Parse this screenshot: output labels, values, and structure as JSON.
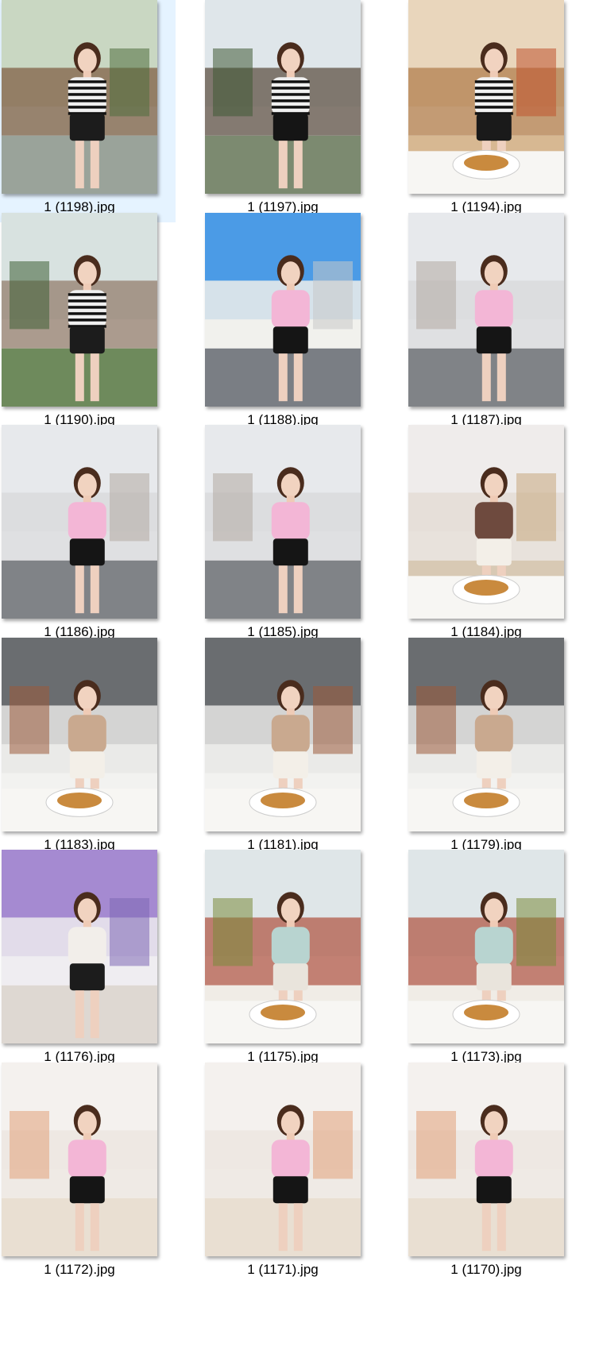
{
  "files": [
    {
      "name": "1 (1198).jpg",
      "selected": true,
      "scene": "garden-brick",
      "top_color": "#f0f0f0",
      "bottom_color": "#1c1c1c",
      "striped": true
    },
    {
      "name": "1 (1197).jpg",
      "selected": false,
      "scene": "garden-house",
      "top_color": "#f0f0f0",
      "bottom_color": "#151515",
      "striped": true
    },
    {
      "name": "1 (1194).jpg",
      "selected": false,
      "scene": "cafe-warm",
      "top_color": "#f2f2f2",
      "bottom_color": "#1a1a1a",
      "striped": true
    },
    {
      "name": "1 (1190).jpg",
      "selected": false,
      "scene": "garden-path",
      "top_color": "#f0f0f0",
      "bottom_color": "#1c1c1c",
      "striped": true
    },
    {
      "name": "1 (1188).jpg",
      "selected": false,
      "scene": "street-sky",
      "top_color": "#f3b6d6",
      "bottom_color": "#151515",
      "striped": false
    },
    {
      "name": "1 (1187).jpg",
      "selected": false,
      "scene": "shopfront",
      "top_color": "#f3b6d6",
      "bottom_color": "#151515",
      "striped": false
    },
    {
      "name": "1 (1186).jpg",
      "selected": false,
      "scene": "shopfront",
      "top_color": "#f3b6d6",
      "bottom_color": "#151515",
      "striped": false
    },
    {
      "name": "1 (1185).jpg",
      "selected": false,
      "scene": "shopfront",
      "top_color": "#f3b6d6",
      "bottom_color": "#151515",
      "striped": false
    },
    {
      "name": "1 (1184).jpg",
      "selected": false,
      "scene": "cafe-white",
      "top_color": "#6e4a3e",
      "bottom_color": "#f3efe8",
      "striped": false
    },
    {
      "name": "1 (1183).jpg",
      "selected": false,
      "scene": "cafe-grey",
      "top_color": "#c9a98f",
      "bottom_color": "#f3efe8",
      "striped": false
    },
    {
      "name": "1 (1181).jpg",
      "selected": false,
      "scene": "cafe-grey",
      "top_color": "#c9a98f",
      "bottom_color": "#f3efe8",
      "striped": false
    },
    {
      "name": "1 (1179).jpg",
      "selected": false,
      "scene": "cafe-grey",
      "top_color": "#c9a98f",
      "bottom_color": "#f3efe8",
      "striped": false
    },
    {
      "name": "1 (1176).jpg",
      "selected": false,
      "scene": "wisteria",
      "top_color": "#f2eeea",
      "bottom_color": "#1c1c1c",
      "striped": false
    },
    {
      "name": "1 (1175).jpg",
      "selected": false,
      "scene": "window-bright",
      "top_color": "#b8d4d0",
      "bottom_color": "#e9e4dc",
      "striped": false
    },
    {
      "name": "1 (1173).jpg",
      "selected": false,
      "scene": "window-bright",
      "top_color": "#b8d4d0",
      "bottom_color": "#e9e4dc",
      "striped": false
    },
    {
      "name": "1 (1172).jpg",
      "selected": false,
      "scene": "studio",
      "top_color": "#f3b6d6",
      "bottom_color": "#151515",
      "striped": false
    },
    {
      "name": "1 (1171).jpg",
      "selected": false,
      "scene": "studio",
      "top_color": "#f3b6d6",
      "bottom_color": "#151515",
      "striped": false
    },
    {
      "name": "1 (1170).jpg",
      "selected": false,
      "scene": "studio",
      "top_color": "#f3b6d6",
      "bottom_color": "#151515",
      "striped": false
    }
  ],
  "colors": {
    "selection": "#e5f3ff",
    "label_text": "#000000",
    "background": "#ffffff"
  }
}
